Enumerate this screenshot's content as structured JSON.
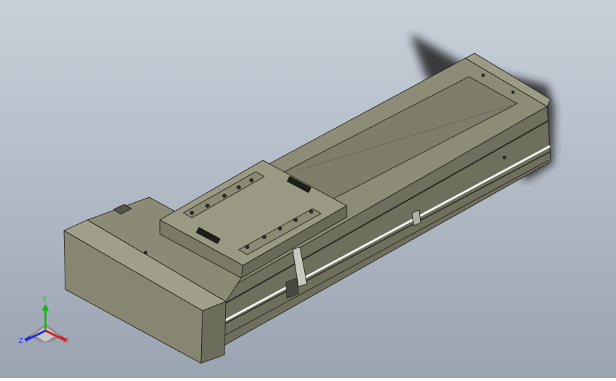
{
  "viewport": {
    "background_top": "#c9d0da",
    "background_bottom": "#9aa3b0"
  },
  "model": {
    "body_color": "#8e8e78",
    "rail_color": "#6f6f5e",
    "edge_color": "#1a1a14"
  },
  "triad": {
    "x_label": "X",
    "y_label": "Y",
    "z_label": "Z",
    "x_color": "#d42020",
    "y_color": "#20b020",
    "z_color": "#2030d8"
  }
}
